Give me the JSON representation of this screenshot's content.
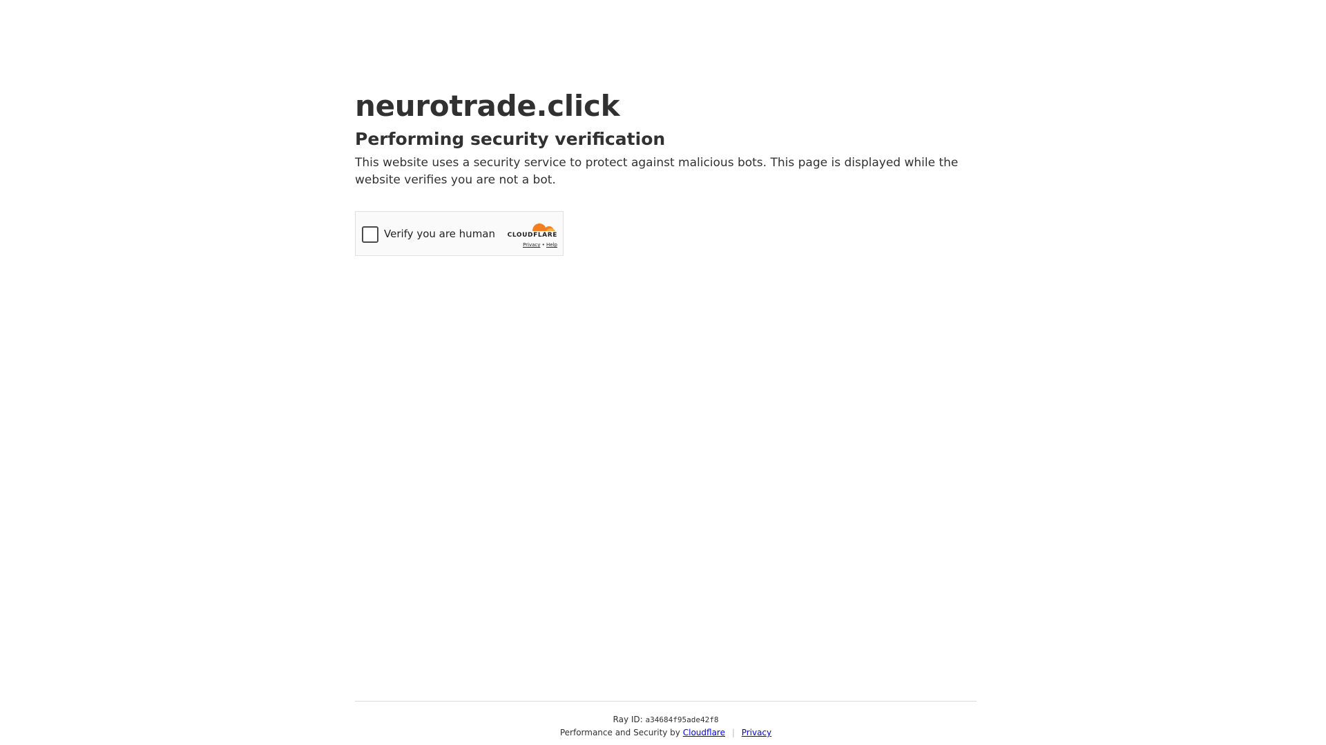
{
  "page": {
    "site_title": "neurotrade.click",
    "subtitle": "Performing security verification",
    "description": "This website uses a security service to protect against malicious bots. This page is displayed while the website verifies you are not a bot."
  },
  "widget": {
    "checkbox_label": "Verify you are human",
    "brand_name": "CLOUDFLARE",
    "privacy_link": "Privacy",
    "link_separator": "•",
    "help_link": "Help",
    "logo_icon": "cloudflare-cloud-icon",
    "brand_color": "#f38020"
  },
  "footer": {
    "ray_label": "Ray ID:",
    "ray_id": "a34684f95ade42f8",
    "perf_text": "Performance and Security by",
    "cloudflare_link": "Cloudflare",
    "separator": "|",
    "privacy_link": "Privacy",
    "link_color": "#0000ee"
  }
}
